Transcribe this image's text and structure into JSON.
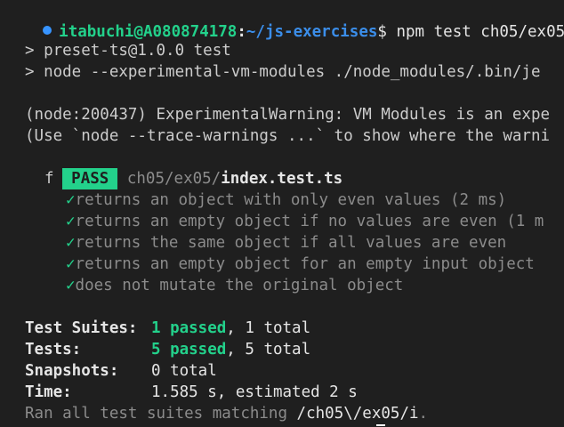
{
  "prompt": {
    "user_host": "itabuchi@A080874178",
    "sep": ":",
    "path": "~/js-exercises",
    "symbol": "$",
    "command": " npm test ch05/ex05"
  },
  "script_lines": [
    "> preset-ts@1.0.0 test",
    "> node --experimental-vm-modules ./node_modules/.bin/je"
  ],
  "warnings": [
    "(node:200437) ExperimentalWarning: VM Modules is an expe",
    "(Use `node --trace-warnings ...` to show where the warni"
  ],
  "result": {
    "badge": "PASS",
    "dir": "ch05/ex05/",
    "file": "index.test.ts"
  },
  "describe_name": "f",
  "tests": [
    {
      "check": "✓",
      "label": "returns an object with only even values (2 ms)"
    },
    {
      "check": "✓",
      "label": "returns an empty object if no values are even (1 m"
    },
    {
      "check": "✓",
      "label": "returns the same object if all values are even"
    },
    {
      "check": "✓",
      "label": "returns an empty object for an empty input object"
    },
    {
      "check": "✓",
      "label": "does not mutate the original object"
    }
  ],
  "summary": {
    "suites_label": "Test Suites:",
    "suites_passed": "1 passed",
    "suites_total": ", 1 total",
    "tests_label": "Tests:",
    "tests_passed": "5 passed",
    "tests_total": ", 5 total",
    "snapshots_label": "Snapshots:",
    "snapshots_value": "0 total",
    "time_label": "Time:",
    "time_value": "1.585 s, estimated 2 s",
    "ran_prefix": "Ran all test suites matching ",
    "ran_pattern": "/ch05\\/ex05/i",
    "ran_suffix": "."
  }
}
